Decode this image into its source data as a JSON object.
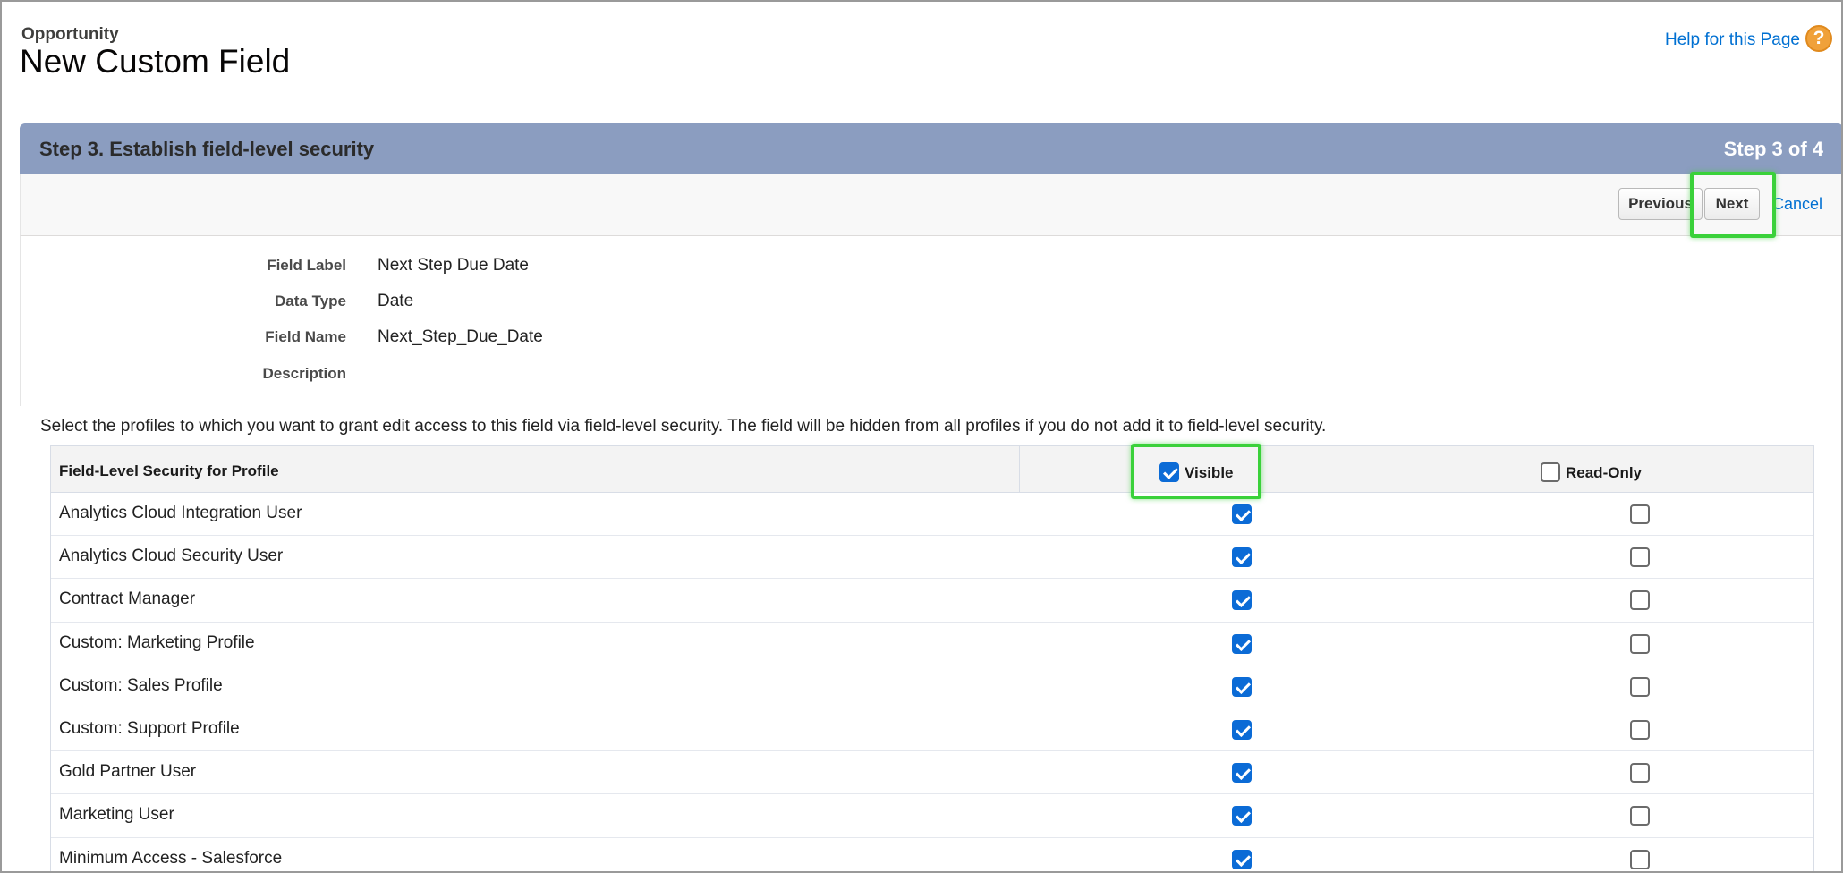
{
  "header": {
    "object_name": "Opportunity",
    "title": "New Custom Field",
    "help_link": "Help for this Page",
    "help_icon": "?"
  },
  "step": {
    "title": "Step 3. Establish field-level security",
    "count": "Step 3 of 4"
  },
  "buttons": {
    "previous": "Previous",
    "next": "Next",
    "cancel": "Cancel"
  },
  "field_info": [
    {
      "label": "Field Label",
      "value": "Next Step Due Date"
    },
    {
      "label": "Data Type",
      "value": "Date"
    },
    {
      "label": "Field Name",
      "value": "Next_Step_Due_Date"
    },
    {
      "label": "Description",
      "value": ""
    }
  ],
  "intro_text": "Select the profiles to which you want to grant edit access to this field via field-level security. The field will be hidden from all profiles if you do not add it to field-level security.",
  "table": {
    "col_profile": "Field-Level Security for Profile",
    "col_visible": "Visible",
    "col_readonly": "Read-Only",
    "visible_all_checked": true,
    "readonly_all_checked": false,
    "rows": [
      {
        "profile": "Analytics Cloud Integration User",
        "visible": true,
        "readonly": false
      },
      {
        "profile": "Analytics Cloud Security User",
        "visible": true,
        "readonly": false
      },
      {
        "profile": "Contract Manager",
        "visible": true,
        "readonly": false
      },
      {
        "profile": "Custom: Marketing Profile",
        "visible": true,
        "readonly": false
      },
      {
        "profile": "Custom: Sales Profile",
        "visible": true,
        "readonly": false
      },
      {
        "profile": "Custom: Support Profile",
        "visible": true,
        "readonly": false
      },
      {
        "profile": "Gold Partner User",
        "visible": true,
        "readonly": false
      },
      {
        "profile": "Marketing User",
        "visible": true,
        "readonly": false
      },
      {
        "profile": "Minimum Access - Salesforce",
        "visible": true,
        "readonly": false
      }
    ]
  },
  "colors": {
    "step_header_bg": "#8b9dc0",
    "link": "#0070d2",
    "checkbox_checked": "#0b6bd6",
    "highlight": "#3ad13a",
    "help_icon": "#f0a13a"
  }
}
